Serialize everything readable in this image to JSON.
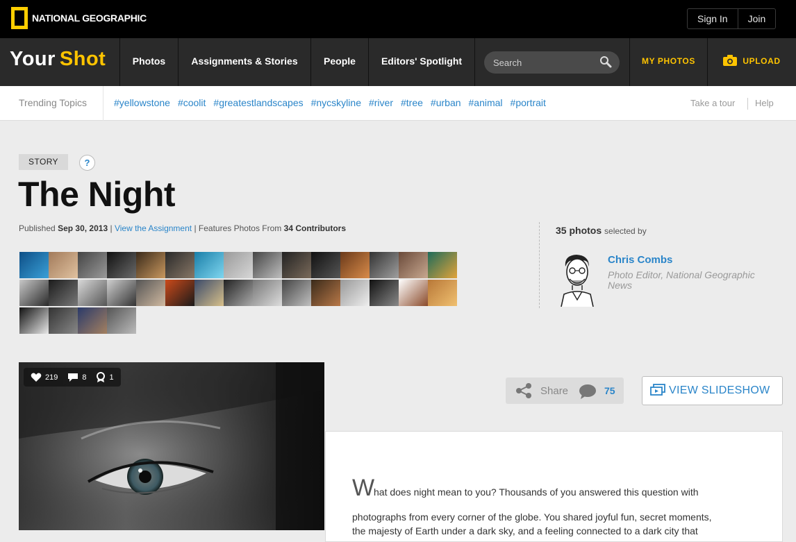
{
  "header": {
    "logo_text": "NATIONAL GEOGRAPHIC",
    "sign_in": "Sign In",
    "join": "Join"
  },
  "nav": {
    "brand_your": "Your",
    "brand_shot": "Shot",
    "photos": "Photos",
    "assignments": "Assignments & Stories",
    "people": "People",
    "spotlight": "Editors' Spotlight",
    "search_placeholder": "Search",
    "my_photos": "MY PHOTOS",
    "upload": "UPLOAD"
  },
  "trending": {
    "label": "Trending Topics",
    "tags": [
      "#yellowstone",
      "#coolit",
      "#greatestlandscapes",
      "#nycskyline",
      "#river",
      "#tree",
      "#urban",
      "#animal",
      "#portrait"
    ],
    "take_tour": "Take a tour",
    "help": "Help"
  },
  "story": {
    "tag": "STORY",
    "help_mark": "?",
    "title": "The Night",
    "published_prefix": "Published",
    "date": "Sep 30, 2013",
    "sep1": "|",
    "view_assignment": "View the Assignment",
    "features_prefix": "| Features Photos From",
    "contributors": "34 Contributors",
    "contributor_count": 34
  },
  "selection": {
    "photo_count": "35 photos",
    "selected_by": "selected by",
    "editor_name": "Chris Combs",
    "editor_role": "Photo Editor, National Geographic News"
  },
  "photo_stats": {
    "likes": "219",
    "comments": "8",
    "awards": "1"
  },
  "share": {
    "label": "Share",
    "comment_count": "75",
    "slideshow": "VIEW SLIDESHOW"
  },
  "article": {
    "dropcap": "W",
    "line1": "hat does night mean to you? Thousands of you answered this question with",
    "line2": "photographs from every corner of the globe. You shared joyful fun, secret moments,",
    "line3": "the majesty of Earth under a dark sky, and a feeling connected to a dark city that"
  },
  "colors": {
    "brand_yellow": "#ffc400",
    "link_blue": "#2a85c9",
    "nav_bg": "#2a2a2a"
  }
}
